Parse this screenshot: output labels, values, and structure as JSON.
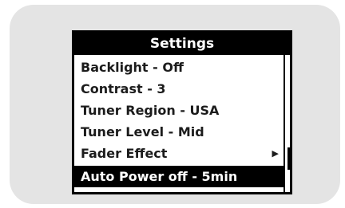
{
  "device_menu": {
    "title": "Settings",
    "items": [
      {
        "label": "Backlight - Off",
        "has_submenu": false,
        "selected": false
      },
      {
        "label": "Contrast - 3",
        "has_submenu": false,
        "selected": false
      },
      {
        "label": "Tuner Region - USA",
        "has_submenu": false,
        "selected": false
      },
      {
        "label": "Tuner Level - Mid",
        "has_submenu": false,
        "selected": false
      },
      {
        "label": "Fader Effect",
        "has_submenu": true,
        "selected": false
      },
      {
        "label": "Auto Power off - 5min",
        "has_submenu": false,
        "selected": true
      }
    ],
    "submenu_icon": "triangle-right-icon"
  },
  "colors": {
    "panel_background": "#e4e4e4",
    "screen_background": "#ffffff",
    "highlight": "#000000",
    "text": "#1c1c1c"
  }
}
